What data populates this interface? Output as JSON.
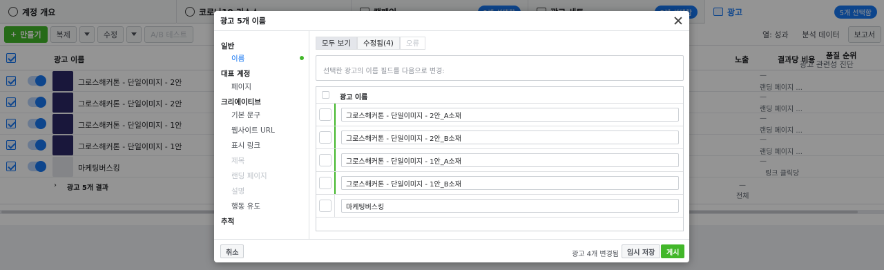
{
  "background": {
    "tabs": [
      {
        "label": "계정 개요"
      },
      {
        "label": "코로나19 리소스"
      },
      {
        "label": "캠페인",
        "badge": "2개 선택함"
      },
      {
        "label": "광고 세트",
        "badge": "5개 선택함"
      },
      {
        "label": "광고",
        "badge": "5개 선택함"
      }
    ],
    "toolbar": {
      "create": "만들기",
      "duplicate": "복제",
      "edit": "수정",
      "ab_test": "A/B 테스트",
      "columns": "열: 성과",
      "breakdown": "분석 데이터",
      "reports": "보고서"
    },
    "columns": {
      "ad_name": "광고 이름",
      "impressions": "노출",
      "cost_per_result": "결과당 비용",
      "quality_rank": "품질 순위",
      "quality_sub": "광고 관련성 진단"
    },
    "rows": [
      {
        "name": "그로스해커톤 - 단일이미지 - 2안",
        "cost": "—",
        "cost_sub": "랜딩 페이지 ..."
      },
      {
        "name": "그로스해커톤 - 단일이미지 - 2안",
        "cost": "—",
        "cost_sub": "랜딩 페이지 ..."
      },
      {
        "name": "그로스해커톤 - 단일이미지 - 1안",
        "cost": "—",
        "cost_sub": "랜딩 페이지 ..."
      },
      {
        "name": "그로스해커톤 - 단일이미지 - 1안",
        "cost": "—",
        "cost_sub": "랜딩 페이지 ..."
      },
      {
        "name": "마케팅버스킹",
        "cost": "—",
        "cost_sub": "링크 클릭당"
      }
    ],
    "summary": {
      "label": "광고 5개 결과",
      "impressions": "—",
      "impressions_sub": "전체"
    }
  },
  "modal": {
    "title": "광고 5개 이름",
    "nav": {
      "general": "일반",
      "name": "이름",
      "identity": "대표 계정",
      "page": "페이지",
      "creative": "크리에이티브",
      "primary_text": "기본 문구",
      "website_url": "웹사이트 URL",
      "display_link": "표시 링크",
      "headline": "제목",
      "landing_page": "랜딩 페이지",
      "description": "설명",
      "cta": "행동 유도",
      "tracking": "추적"
    },
    "filters": {
      "all": "모두 보기",
      "modified": "수정됨(4)",
      "errors": "오류"
    },
    "instruction": "선택한 광고의 이름 필드를 다음으로 변경:",
    "table_header": "광고 이름",
    "ad_names": [
      "그로스해커톤 - 단일이미지 - 2안_A소재",
      "그로스해커톤 - 단일이미지 - 2안_B소재",
      "그로스해커톤 - 단일이미지 - 1안_A소재",
      "그로스해커톤 - 단일이미지 - 1안_B소재",
      "마케팅버스킹"
    ],
    "footer": {
      "cancel": "취소",
      "status": "광고 4개 변경됨",
      "save_draft": "임시 저장",
      "publish": "게시"
    }
  }
}
